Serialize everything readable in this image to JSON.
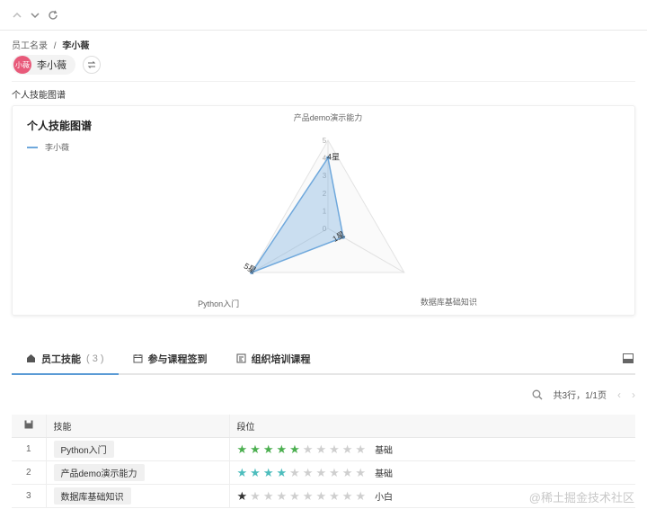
{
  "breadcrumb": {
    "parent": "员工名录",
    "sep": "/",
    "current": "李小薇"
  },
  "user": {
    "avatar_text": "小薇",
    "name": "李小薇",
    "avatar_color": "#e85a7a"
  },
  "section_label": "个人技能图谱",
  "card": {
    "title": "个人技能图谱",
    "legend": "李小薇"
  },
  "chart_data": {
    "type": "radar",
    "title": "个人技能图谱",
    "legend": [
      "李小薇"
    ],
    "indicators": [
      "产品demo演示能力",
      "数据库基础知识",
      "Python入门"
    ],
    "max": 5,
    "ticks": [
      "0",
      "1",
      "2",
      "3",
      "4",
      "5"
    ],
    "series": [
      {
        "name": "李小薇",
        "values": [
          4,
          1,
          5
        ]
      }
    ],
    "value_labels": [
      "4星",
      "1星",
      "5星"
    ],
    "color": "#6fa8dc"
  },
  "tabs": [
    {
      "label": "员工技能",
      "count": "( 3 )",
      "icon": "home-icon"
    },
    {
      "label": "参与课程签到",
      "icon": "calendar-icon"
    },
    {
      "label": "组织培训课程",
      "icon": "course-icon"
    }
  ],
  "pagination": {
    "summary": "共3行，1/1页",
    "prev": "‹",
    "next": "›"
  },
  "table": {
    "headers": [
      "技能",
      "段位"
    ],
    "rows": [
      {
        "idx": "1",
        "skill": "Python入门",
        "filled": 5,
        "total": 10,
        "star_color": "#4caf50",
        "level": "基础"
      },
      {
        "idx": "2",
        "skill": "产品demo演示能力",
        "filled": 4,
        "total": 10,
        "star_color": "#4dbdbd",
        "level": "基础"
      },
      {
        "idx": "3",
        "skill": "数据库基础知识",
        "filled": 1,
        "total": 10,
        "star_color": "#333333",
        "level": "小白"
      }
    ]
  },
  "watermark": "@稀土掘金技术社区"
}
